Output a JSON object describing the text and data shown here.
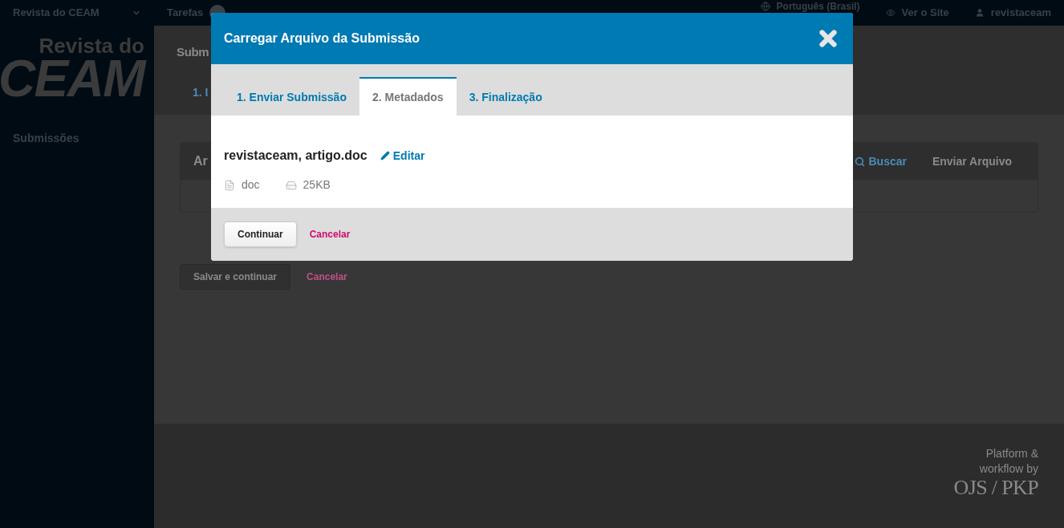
{
  "top_bar": {
    "journal_menu": "Revista do CEAM",
    "tasks": {
      "label": "Tarefas"
    },
    "language": "Português (Brasil)",
    "view_site": "Ver o Site",
    "user": "revistaceam"
  },
  "sidebar": {
    "logo": {
      "line_1": "Revista do",
      "line_2": "CEAM"
    },
    "items": [
      {
        "label": "Submissões"
      }
    ]
  },
  "page": {
    "title": "Subm",
    "tab_label": "1. I",
    "card": {
      "title": "Ar",
      "actions": [
        {
          "label": "Buscar",
          "kind": "search"
        },
        {
          "label": "Enviar Arquivo",
          "kind": "plain"
        }
      ]
    },
    "buttons": {
      "save": "Salvar e continuar",
      "cancel": "Cancelar"
    }
  },
  "footer": {
    "lines": [
      "Platform &",
      "workflow by"
    ],
    "brand": "OJS / PKP"
  },
  "modal": {
    "title": "Carregar Arquivo da Submissão",
    "tabs": [
      {
        "label": "1. Enviar Submissão",
        "selected": false
      },
      {
        "label": "2. Metadados",
        "selected": true
      },
      {
        "label": "3. Finalização",
        "selected": false
      }
    ],
    "file": {
      "name": "revistaceam, artigo.doc",
      "edit": "Editar",
      "type": "doc",
      "size": "25KB"
    },
    "buttons": {
      "primary": "Continuar",
      "cancel": "Cancelar"
    }
  }
}
